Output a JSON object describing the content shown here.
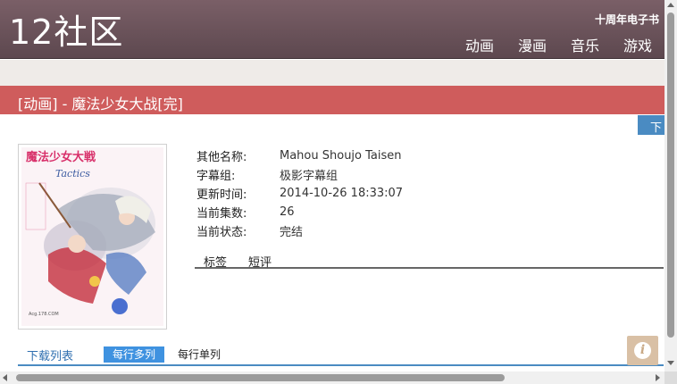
{
  "header": {
    "logo": "12社区",
    "anniversary_link": "十周年电子书",
    "nav": [
      "动画",
      "漫画",
      "音乐",
      "游戏"
    ]
  },
  "page_title": "[动画] - 魔法少女大战[完]",
  "download_button": "下",
  "cover": {
    "alt_title_art": "魔法少女大戦",
    "sub_art": "Tactics"
  },
  "info": [
    {
      "label": "其他名称:",
      "value": "Mahou Shoujo Taisen"
    },
    {
      "label": "字幕组:",
      "value": "极影字幕组"
    },
    {
      "label": "更新时间:",
      "value": "2014-10-26 18:33:07"
    },
    {
      "label": "当前集数:",
      "value": "26"
    },
    {
      "label": "当前状态:",
      "value": "完结"
    }
  ],
  "tabs": [
    "标签",
    "短评"
  ],
  "download_section": {
    "title": "下载列表",
    "option_active": "每行多列",
    "option_inactive": "每行单列"
  },
  "info_button_icon": "info-icon",
  "colors": {
    "header": "#6b535a",
    "title_bar": "#cf5c5c",
    "accent_blue": "#3f92e0"
  }
}
